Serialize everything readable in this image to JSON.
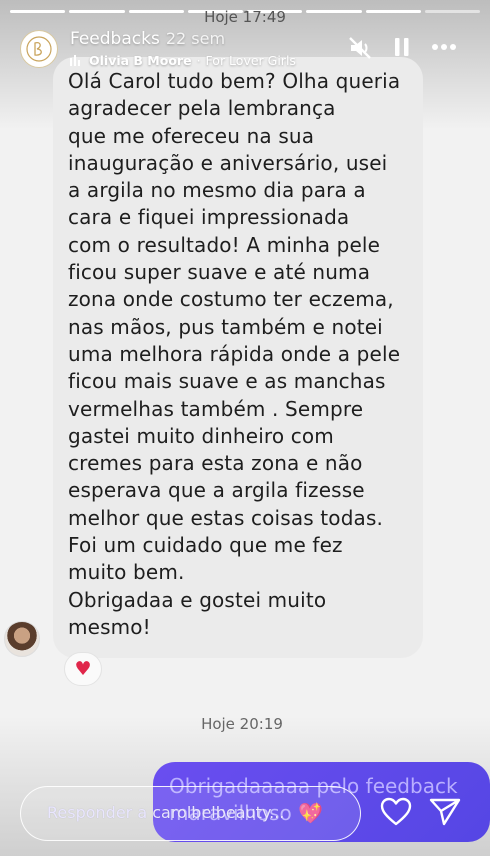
{
  "story": {
    "progress_total": 8,
    "progress_done": 7,
    "timestamp_top": "Hoje 17:49"
  },
  "header": {
    "title": "Feedbacks",
    "time_ago": "22 sem",
    "music_artist": "Olivia B Moore",
    "music_separator": "·",
    "music_track": "For Lover Girls",
    "icons": [
      "mute-icon",
      "pause-icon",
      "more-icon"
    ]
  },
  "message": {
    "text": "Olá Carol tudo bem? Olha queria\nagradecer pela lembrança\nque me ofereceu na sua\ninauguração e aniversário, usei\na argila no mesmo dia para a\ncara e fiquei impressionada\ncom o resultado! A minha pele\nficou super suave e até numa\nzona onde costumo ter eczema,\nnas mãos, pus também e  notei\numa melhora rápida onde a pele\nficou mais suave e as manchas\nvermelhas também . Sempre\ngastei muito dinheiro com\ncremes para esta zona e não\nesperava que a argila fizesse\nmelhor que estas coisas todas.\nFoi um cuidado que me fez\nmuito bem.\nObrigadaa e gostei muito\nmesmo!",
    "reaction": "♥"
  },
  "timestamp_mid": "Hoje 20:19",
  "reply_message": {
    "text": "Obrigadaaaaa pelo feedback maravilhoso 💖"
  },
  "reply_bar": {
    "placeholder": "Responder a carolbelbeauty..."
  },
  "colors": {
    "accent": "#5b47e6",
    "heart": "#e0264a"
  }
}
